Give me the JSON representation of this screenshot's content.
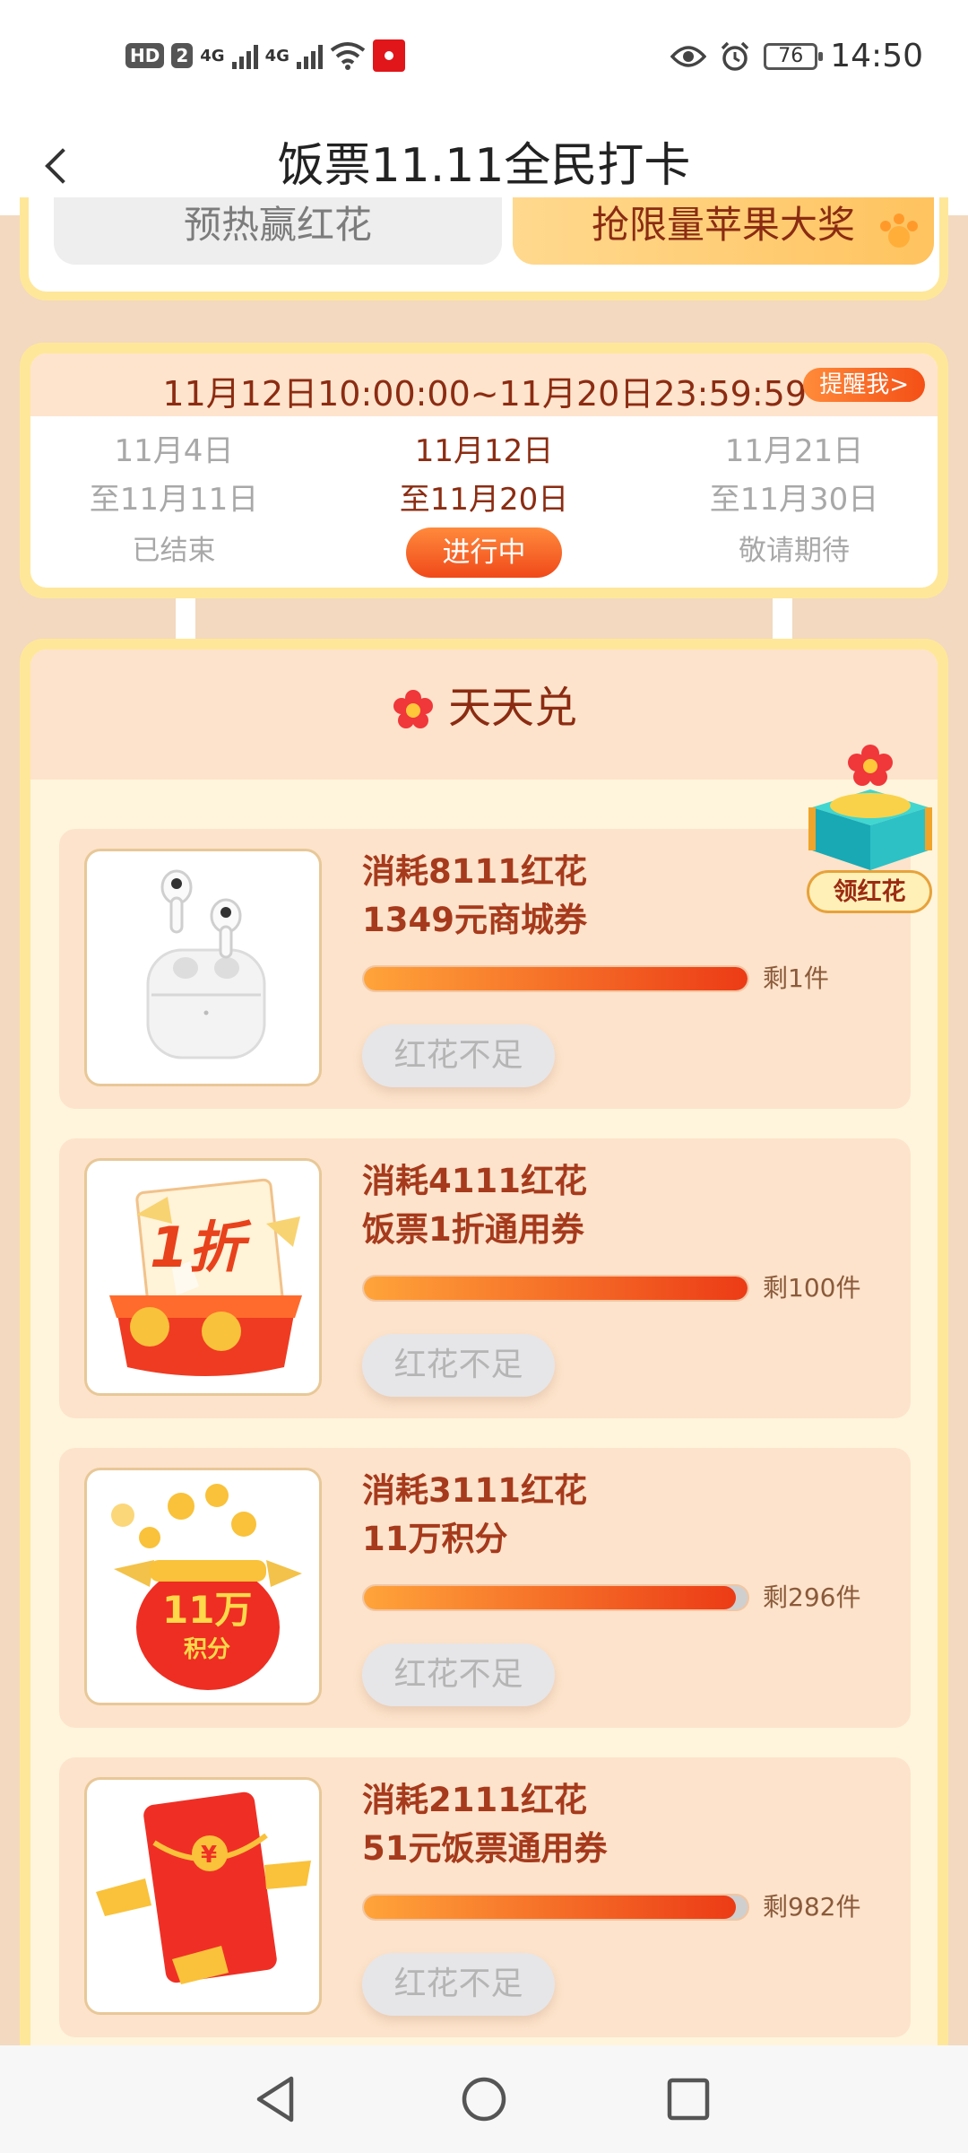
{
  "status_bar": {
    "hd_badge": "HD",
    "sim_number": "2",
    "net1": "4G",
    "net2": "4G",
    "battery": "76",
    "time": "14:50"
  },
  "nav": {
    "title": "饭票11.11全民打卡"
  },
  "top_tabs": {
    "left": "预热赢红花",
    "right": "抢限量苹果大奖"
  },
  "schedule": {
    "range": "11月12日10:00:00~11月20日23:59:59",
    "remind_label": "提醒我>",
    "periods": [
      {
        "start": "11月4日",
        "end": "至11月11日",
        "status": "已结束"
      },
      {
        "start": "11月12日",
        "end": "至11月20日",
        "status": "进行中"
      },
      {
        "start": "11月21日",
        "end": "至11月30日",
        "status": "敬请期待"
      }
    ]
  },
  "exchange": {
    "title": "天天兑",
    "floating_label": "领红花",
    "items": [
      {
        "cost": "消耗8111红花",
        "name": "1349元商城券",
        "stock": "剩1件",
        "button": "红花不足",
        "image_icon": "earbuds-icon"
      },
      {
        "cost": "消耗4111红花",
        "name": "饭票1折通用券",
        "stock": "剩100件",
        "button": "红花不足",
        "image_icon": "discount-coupon-icon",
        "image_text": "1折"
      },
      {
        "cost": "消耗3111红花",
        "name": "11万积分",
        "stock": "剩296件",
        "button": "红花不足",
        "image_icon": "points-pouch-icon",
        "image_text_1": "11万",
        "image_text_2": "积分"
      },
      {
        "cost": "消耗2111红花",
        "name": "51元饭票通用券",
        "stock": "剩982件",
        "button": "红花不足",
        "image_icon": "red-envelope-icon"
      }
    ]
  },
  "colors": {
    "accent": "#f0491a",
    "title_brown": "#8b2c12",
    "frame_yellow": "#ffe79a",
    "card_peach": "#fde3cb"
  }
}
